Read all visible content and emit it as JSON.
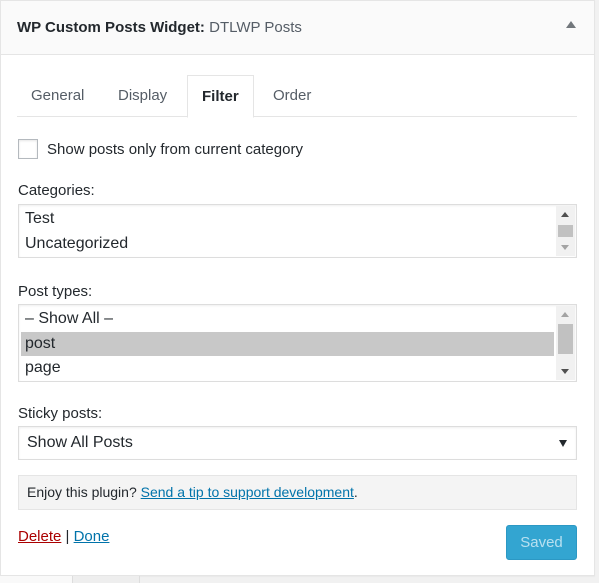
{
  "widget": {
    "title": "WP Custom Posts Widget:",
    "in_title": "DTLWP Posts",
    "toggle_icon": "triangle-up-icon"
  },
  "tabs": [
    {
      "label": "General",
      "active": false
    },
    {
      "label": "Display",
      "active": false
    },
    {
      "label": "Filter",
      "active": true
    },
    {
      "label": "Order",
      "active": false
    }
  ],
  "filter": {
    "current_category_checkbox": {
      "label": "Show posts only from current category",
      "checked": false
    },
    "categories": {
      "label": "Categories:",
      "options": [
        "Test",
        "Uncategorized"
      ],
      "selected": []
    },
    "post_types": {
      "label": "Post types:",
      "options": [
        "– Show All –",
        "post",
        "page"
      ],
      "selected": [
        "post"
      ]
    },
    "sticky_posts": {
      "label": "Sticky posts:",
      "value": "Show All Posts"
    }
  },
  "notice": {
    "text": "Enjoy this plugin? ",
    "link": "Send a tip to support development",
    "suffix": "."
  },
  "actions": {
    "delete": "Delete",
    "separator": " | ",
    "done": "Done",
    "save_button": "Saved"
  },
  "colors": {
    "link": "#0073aa",
    "delete": "#aa0000",
    "save_button": "#33a5d1",
    "selected_option": "#c8c8c8"
  }
}
